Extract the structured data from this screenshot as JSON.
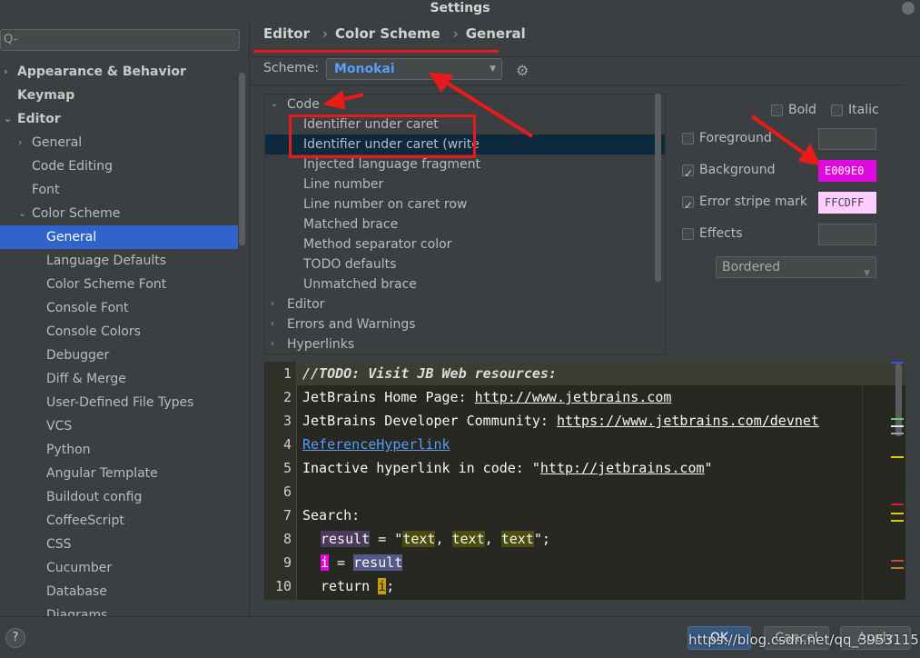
{
  "window": {
    "title": "Settings"
  },
  "sidebar": {
    "search_placeholder": "Q-",
    "items": [
      {
        "label": "Appearance & Behavior",
        "level": 0,
        "bold": true,
        "arrow": "›"
      },
      {
        "label": "Keymap",
        "level": 0,
        "bold": true,
        "arrow": ""
      },
      {
        "label": "Editor",
        "level": 0,
        "bold": true,
        "arrow": "⌄"
      },
      {
        "label": "General",
        "level": 1,
        "arrow": "›"
      },
      {
        "label": "Code Editing",
        "level": 1,
        "arrow": ""
      },
      {
        "label": "Font",
        "level": 1,
        "arrow": ""
      },
      {
        "label": "Color Scheme",
        "level": 1,
        "arrow": "⌄"
      },
      {
        "label": "General",
        "level": 2,
        "selected": true,
        "arrow": ""
      },
      {
        "label": "Language Defaults",
        "level": 2,
        "arrow": ""
      },
      {
        "label": "Color Scheme Font",
        "level": 2,
        "arrow": ""
      },
      {
        "label": "Console Font",
        "level": 2,
        "arrow": ""
      },
      {
        "label": "Console Colors",
        "level": 2,
        "arrow": ""
      },
      {
        "label": "Debugger",
        "level": 2,
        "arrow": ""
      },
      {
        "label": "Diff & Merge",
        "level": 2,
        "arrow": ""
      },
      {
        "label": "User-Defined File Types",
        "level": 2,
        "arrow": ""
      },
      {
        "label": "VCS",
        "level": 2,
        "arrow": ""
      },
      {
        "label": "Python",
        "level": 2,
        "arrow": ""
      },
      {
        "label": "Angular Template",
        "level": 2,
        "arrow": ""
      },
      {
        "label": "Buildout config",
        "level": 2,
        "arrow": ""
      },
      {
        "label": "CoffeeScript",
        "level": 2,
        "arrow": ""
      },
      {
        "label": "CSS",
        "level": 2,
        "arrow": ""
      },
      {
        "label": "Cucumber",
        "level": 2,
        "arrow": ""
      },
      {
        "label": "Database",
        "level": 2,
        "arrow": ""
      },
      {
        "label": "Diagrams",
        "level": 2,
        "arrow": ""
      }
    ]
  },
  "breadcrumb": [
    "Editor",
    "Color Scheme",
    "General"
  ],
  "scheme": {
    "label": "Scheme:",
    "value": "Monokai"
  },
  "code_tree": [
    {
      "label": "Code",
      "level": 0,
      "arrow": "⌄"
    },
    {
      "label": "Identifier under caret",
      "level": 1
    },
    {
      "label": "Identifier under caret (write",
      "level": 1,
      "selected": true
    },
    {
      "label": "Injected language fragment",
      "level": 1
    },
    {
      "label": "Line number",
      "level": 1
    },
    {
      "label": "Line number on caret row",
      "level": 1
    },
    {
      "label": "Matched brace",
      "level": 1
    },
    {
      "label": "Method separator color",
      "level": 1
    },
    {
      "label": "TODO defaults",
      "level": 1
    },
    {
      "label": "Unmatched brace",
      "level": 1
    },
    {
      "label": "Editor",
      "level": 0,
      "arrow": "›"
    },
    {
      "label": "Errors and Warnings",
      "level": 0,
      "arrow": "›"
    },
    {
      "label": "Hyperlinks",
      "level": 0,
      "arrow": "›"
    }
  ],
  "props": {
    "bold": {
      "label": "Bold",
      "checked": false
    },
    "italic": {
      "label": "Italic",
      "checked": false
    },
    "foreground": {
      "label": "Foreground",
      "checked": false,
      "value": ""
    },
    "background": {
      "label": "Background",
      "checked": true,
      "value": "E009E0",
      "color": "#e009e0"
    },
    "error_stripe": {
      "label": "Error stripe mark",
      "checked": true,
      "value": "FFCDFF",
      "color": "#ffcdff"
    },
    "effects": {
      "label": "Effects",
      "checked": false,
      "value": ""
    },
    "effect_type": "Bordered"
  },
  "editor": {
    "line_numbers": [
      "1",
      "2",
      "3",
      "4",
      "5",
      "6",
      "7",
      "8",
      "9",
      "10"
    ],
    "l1": "//TODO: Visit JB Web resources:",
    "l2a": "JetBrains Home Page: ",
    "l2b": "http://www.jetbrains.com",
    "l3a": "JetBrains Developer Community: ",
    "l3b": "https://www.jetbrains.com/devnet",
    "l4": "ReferenceHyperlink",
    "l5a": "Inactive hyperlink in code: \"",
    "l5b": "http://jetbrains.com",
    "l5c": "\"",
    "l7": "Search:",
    "l8a": "result",
    "l8b": " = \"",
    "l8c": "text",
    "l8d": ", ",
    "l8e": "text",
    "l8f": ", ",
    "l8g": "text",
    "l8h": "\";",
    "l9a": "i",
    "l9b": " = ",
    "l9c": "result",
    "l10a": "return ",
    "l10b": "i",
    "l10c": ";"
  },
  "footer": {
    "help": "?",
    "ok": "OK",
    "cancel": "Cancel",
    "apply": "Apply",
    "watermark": "https://blog.csdn.net/qq_39531155"
  }
}
